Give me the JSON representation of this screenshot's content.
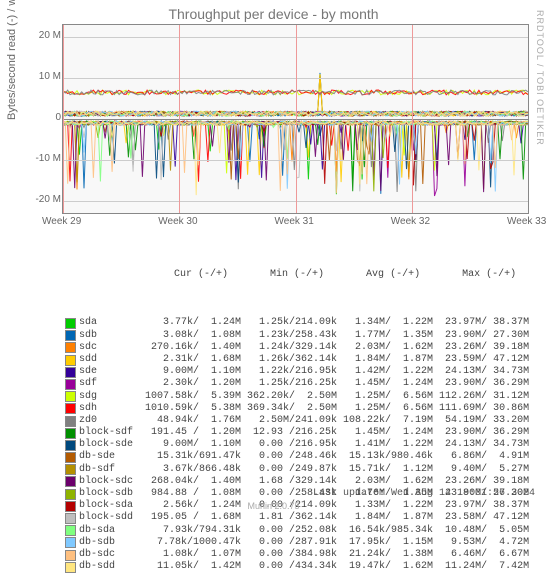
{
  "title": "Throughput per device - by month",
  "ylabel": "Bytes/second read (-) / write (+)",
  "watermark": "RRDTOOL / TOBI OETIKER",
  "footer": "Munin 2.0.75",
  "last_update": "Last update: Wed Aug 14 18:01:56 2024",
  "chart_data": {
    "type": "line",
    "yticks": [
      {
        "label": "20 M",
        "value": 20
      },
      {
        "label": "10 M",
        "value": 10
      },
      {
        "label": "0",
        "value": 0
      },
      {
        "label": "-10 M",
        "value": -10
      },
      {
        "label": "-20 M",
        "value": -20
      }
    ],
    "ylim": [
      -23,
      23
    ],
    "xcategories": [
      "Week 29",
      "Week 30",
      "Week 31",
      "Week 32",
      "Week 33"
    ],
    "header": "            Cur (-/+)       Min (-/+)       Avg (-/+)       Max (-/+)",
    "series": [
      {
        "name": "sda",
        "color": "#00cc00",
        "cur": "   3.77k/  1.24M",
        "min": "  1.25k/214.09k",
        "avg": "  1.34M/  1.22M",
        "max": " 23.97M/ 38.37M"
      },
      {
        "name": "sdb",
        "color": "#0066b3",
        "cur": "   3.08k/  1.08M",
        "min": "  1.23k/258.43k",
        "avg": "  1.77M/  1.35M",
        "max": " 23.90M/ 27.30M"
      },
      {
        "name": "sdc",
        "color": "#ff8000",
        "cur": " 270.16k/  1.40M",
        "min": "  1.24k/329.14k",
        "avg": "  2.03M/  1.62M",
        "max": " 23.26M/ 39.18M"
      },
      {
        "name": "sdd",
        "color": "#ffcc00",
        "cur": "   2.31k/  1.68M",
        "min": "  1.26k/362.14k",
        "avg": "  1.84M/  1.87M",
        "max": " 23.59M/ 47.12M"
      },
      {
        "name": "sde",
        "color": "#330099",
        "cur": "   9.00M/  1.10M",
        "min": "  1.22k/216.95k",
        "avg": "  1.42M/  1.22M",
        "max": " 24.13M/ 34.73M"
      },
      {
        "name": "sdf",
        "color": "#990099",
        "cur": "   2.30k/  1.20M",
        "min": "  1.25k/216.25k",
        "avg": "  1.45M/  1.24M",
        "max": " 23.90M/ 36.29M"
      },
      {
        "name": "sdg",
        "color": "#ccff00",
        "cur": "1007.58k/  5.39M",
        "min": "362.20k/  2.50M",
        "avg": "  1.25M/  6.56M",
        "max": "112.26M/ 31.12M"
      },
      {
        "name": "sdh",
        "color": "#ff0000",
        "cur": "1010.59k/  5.38M",
        "min": "369.34k/  2.50M",
        "avg": "  1.25M/  6.56M",
        "max": "111.69M/ 30.86M"
      },
      {
        "name": "zd0",
        "color": "#808080",
        "cur": "  48.94k/  1.76M",
        "min": "  2.50M/241.09k",
        "avg": "108.22k/  7.19M",
        "max": " 54.19M/ 33.20M"
      },
      {
        "name": "block-sdf",
        "color": "#008f00",
        "cur": " 191.45 /  1.20M",
        "min": " 12.93 /216.25k",
        "avg": "  1.45M/  1.24M",
        "max": " 23.90M/ 36.29M"
      },
      {
        "name": "block-sde",
        "color": "#00487d",
        "cur": "   9.00M/  1.10M",
        "min": "  0.00 /216.95k",
        "avg": "  1.41M/  1.22M",
        "max": " 24.13M/ 34.73M"
      },
      {
        "name": "db-sde",
        "color": "#b35a00",
        "cur": "  15.31k/691.47k",
        "min": "  0.00 /248.46k",
        "avg": " 15.13k/980.46k",
        "max": "  6.86M/  4.91M"
      },
      {
        "name": "db-sdf",
        "color": "#b38f00",
        "cur": "   3.67k/866.48k",
        "min": "  0.00 /249.87k",
        "avg": " 15.71k/  1.12M",
        "max": "  9.40M/  5.27M"
      },
      {
        "name": "block-sdc",
        "color": "#6b006b",
        "cur": " 268.04k/  1.40M",
        "min": "  1.68 /329.14k",
        "avg": "  2.03M/  1.62M",
        "max": " 23.26M/ 39.18M"
      },
      {
        "name": "block-sdb",
        "color": "#8fb300",
        "cur": " 984.88 /  1.08M",
        "min": "  0.00 /258.43k",
        "avg": "  1.76M/  1.35M",
        "max": " 23.90M/ 27.30M"
      },
      {
        "name": "block-sda",
        "color": "#b30000",
        "cur": "   2.56k/  1.24M",
        "min": "  0.00 /214.09k",
        "avg": "  1.33M/  1.22M",
        "max": " 23.97M/ 38.37M"
      },
      {
        "name": "block-sdd",
        "color": "#bebebe",
        "cur": " 195.05 /  1.68M",
        "min": "  1.81 /362.14k",
        "avg": "  1.84M/  1.87M",
        "max": " 23.58M/ 47.12M"
      },
      {
        "name": "db-sda",
        "color": "#80ff80",
        "cur": "   7.93k/794.31k",
        "min": "  0.00 /252.08k",
        "avg": " 16.54k/985.34k",
        "max": " 10.48M/  5.05M"
      },
      {
        "name": "db-sdb",
        "color": "#80c9ff",
        "cur": "   7.78k/1000.47k",
        "min": " 0.00 /287.91k",
        "avg": " 17.95k/  1.15M",
        "max": "  9.53M/  4.72M"
      },
      {
        "name": "db-sdc",
        "color": "#ffc080",
        "cur": "   1.08k/  1.07M",
        "min": "  0.00 /384.98k",
        "avg": " 21.24k/  1.38M",
        "max": "  6.46M/  6.67M"
      },
      {
        "name": "db-sdd",
        "color": "#ffe680",
        "cur": "  11.05k/  1.42M",
        "min": "  0.00 /434.34k",
        "avg": " 19.47k/  1.62M",
        "max": " 11.24M/  7.42M"
      }
    ]
  }
}
